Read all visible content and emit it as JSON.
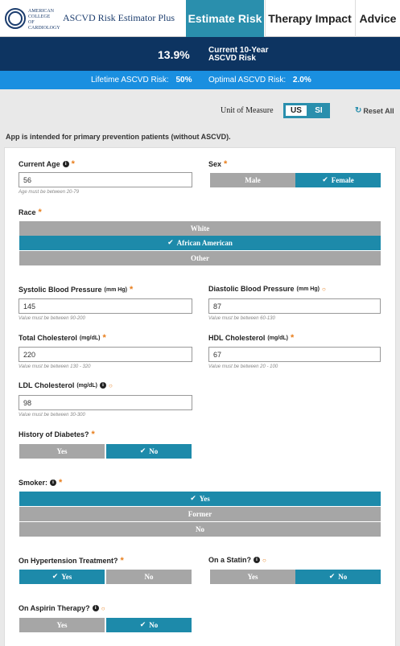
{
  "header": {
    "logo_text": "AMERICAN COLLEGE of CARDIOLOGY",
    "app_title": "ASCVD Risk Estimator Plus",
    "tabs": [
      {
        "label": "Estimate Risk",
        "active": true
      },
      {
        "label": "Therapy Impact",
        "active": false
      },
      {
        "label": "Advice",
        "active": false
      }
    ]
  },
  "risk": {
    "current_value": "13.9%",
    "current_label": "Current 10-Year ASCVD Risk",
    "lifetime_label": "Lifetime ASCVD Risk:",
    "lifetime_value": "50%",
    "optimal_label": "Optimal ASCVD Risk:",
    "optimal_value": "2.0%"
  },
  "toolbar": {
    "unit_label": "Unit of Measure",
    "unit_options": [
      "US",
      "SI"
    ],
    "unit_selected": "US",
    "reset_label": "Reset All"
  },
  "notice": "App is intended for primary prevention patients (without ASCVD).",
  "form": {
    "age": {
      "label": "Current Age",
      "value": "56",
      "hint": "Age must be between 20-79"
    },
    "sex": {
      "label": "Sex",
      "options": [
        "Male",
        "Female"
      ],
      "selected": "Female"
    },
    "race": {
      "label": "Race",
      "options": [
        "White",
        "African American",
        "Other"
      ],
      "selected": "African American"
    },
    "sbp": {
      "label": "Systolic Blood Pressure",
      "unit": "(mm Hg)",
      "value": "145",
      "hint": "Value must be between 90-200"
    },
    "dbp": {
      "label": "Diastolic Blood Pressure",
      "unit": "(mm Hg)",
      "value": "87",
      "hint": "Value must be between 60-130"
    },
    "tc": {
      "label": "Total Cholesterol",
      "unit": "(mg/dL)",
      "value": "220",
      "hint": "Value must be between 130 - 320"
    },
    "hdl": {
      "label": "HDL Cholesterol",
      "unit": "(mg/dL)",
      "value": "67",
      "hint": "Value must be between 20 - 100"
    },
    "ldl": {
      "label": "LDL Cholesterol",
      "unit": "(mg/dL)",
      "value": "98",
      "hint": "Value must be between 30-300"
    },
    "diabetes": {
      "label": "History of Diabetes?",
      "options": [
        "Yes",
        "No"
      ],
      "selected": "No"
    },
    "smoker": {
      "label": "Smoker:",
      "options": [
        "Yes",
        "Former",
        "No"
      ],
      "selected": "Yes"
    },
    "htn": {
      "label": "On Hypertension Treatment?",
      "options": [
        "Yes",
        "No"
      ],
      "selected": "Yes"
    },
    "statin": {
      "label": "On a Statin?",
      "options": [
        "Yes",
        "No"
      ],
      "selected": "No"
    },
    "aspirin": {
      "label": "On Aspirin Therapy?",
      "options": [
        "Yes",
        "No"
      ],
      "selected": "No"
    }
  },
  "colors": {
    "accent": "#2a8fad",
    "navy": "#0d3461",
    "sub_bar": "#1a8fe0",
    "required": "#e87e1c",
    "unselected": "#a6a6a6"
  }
}
